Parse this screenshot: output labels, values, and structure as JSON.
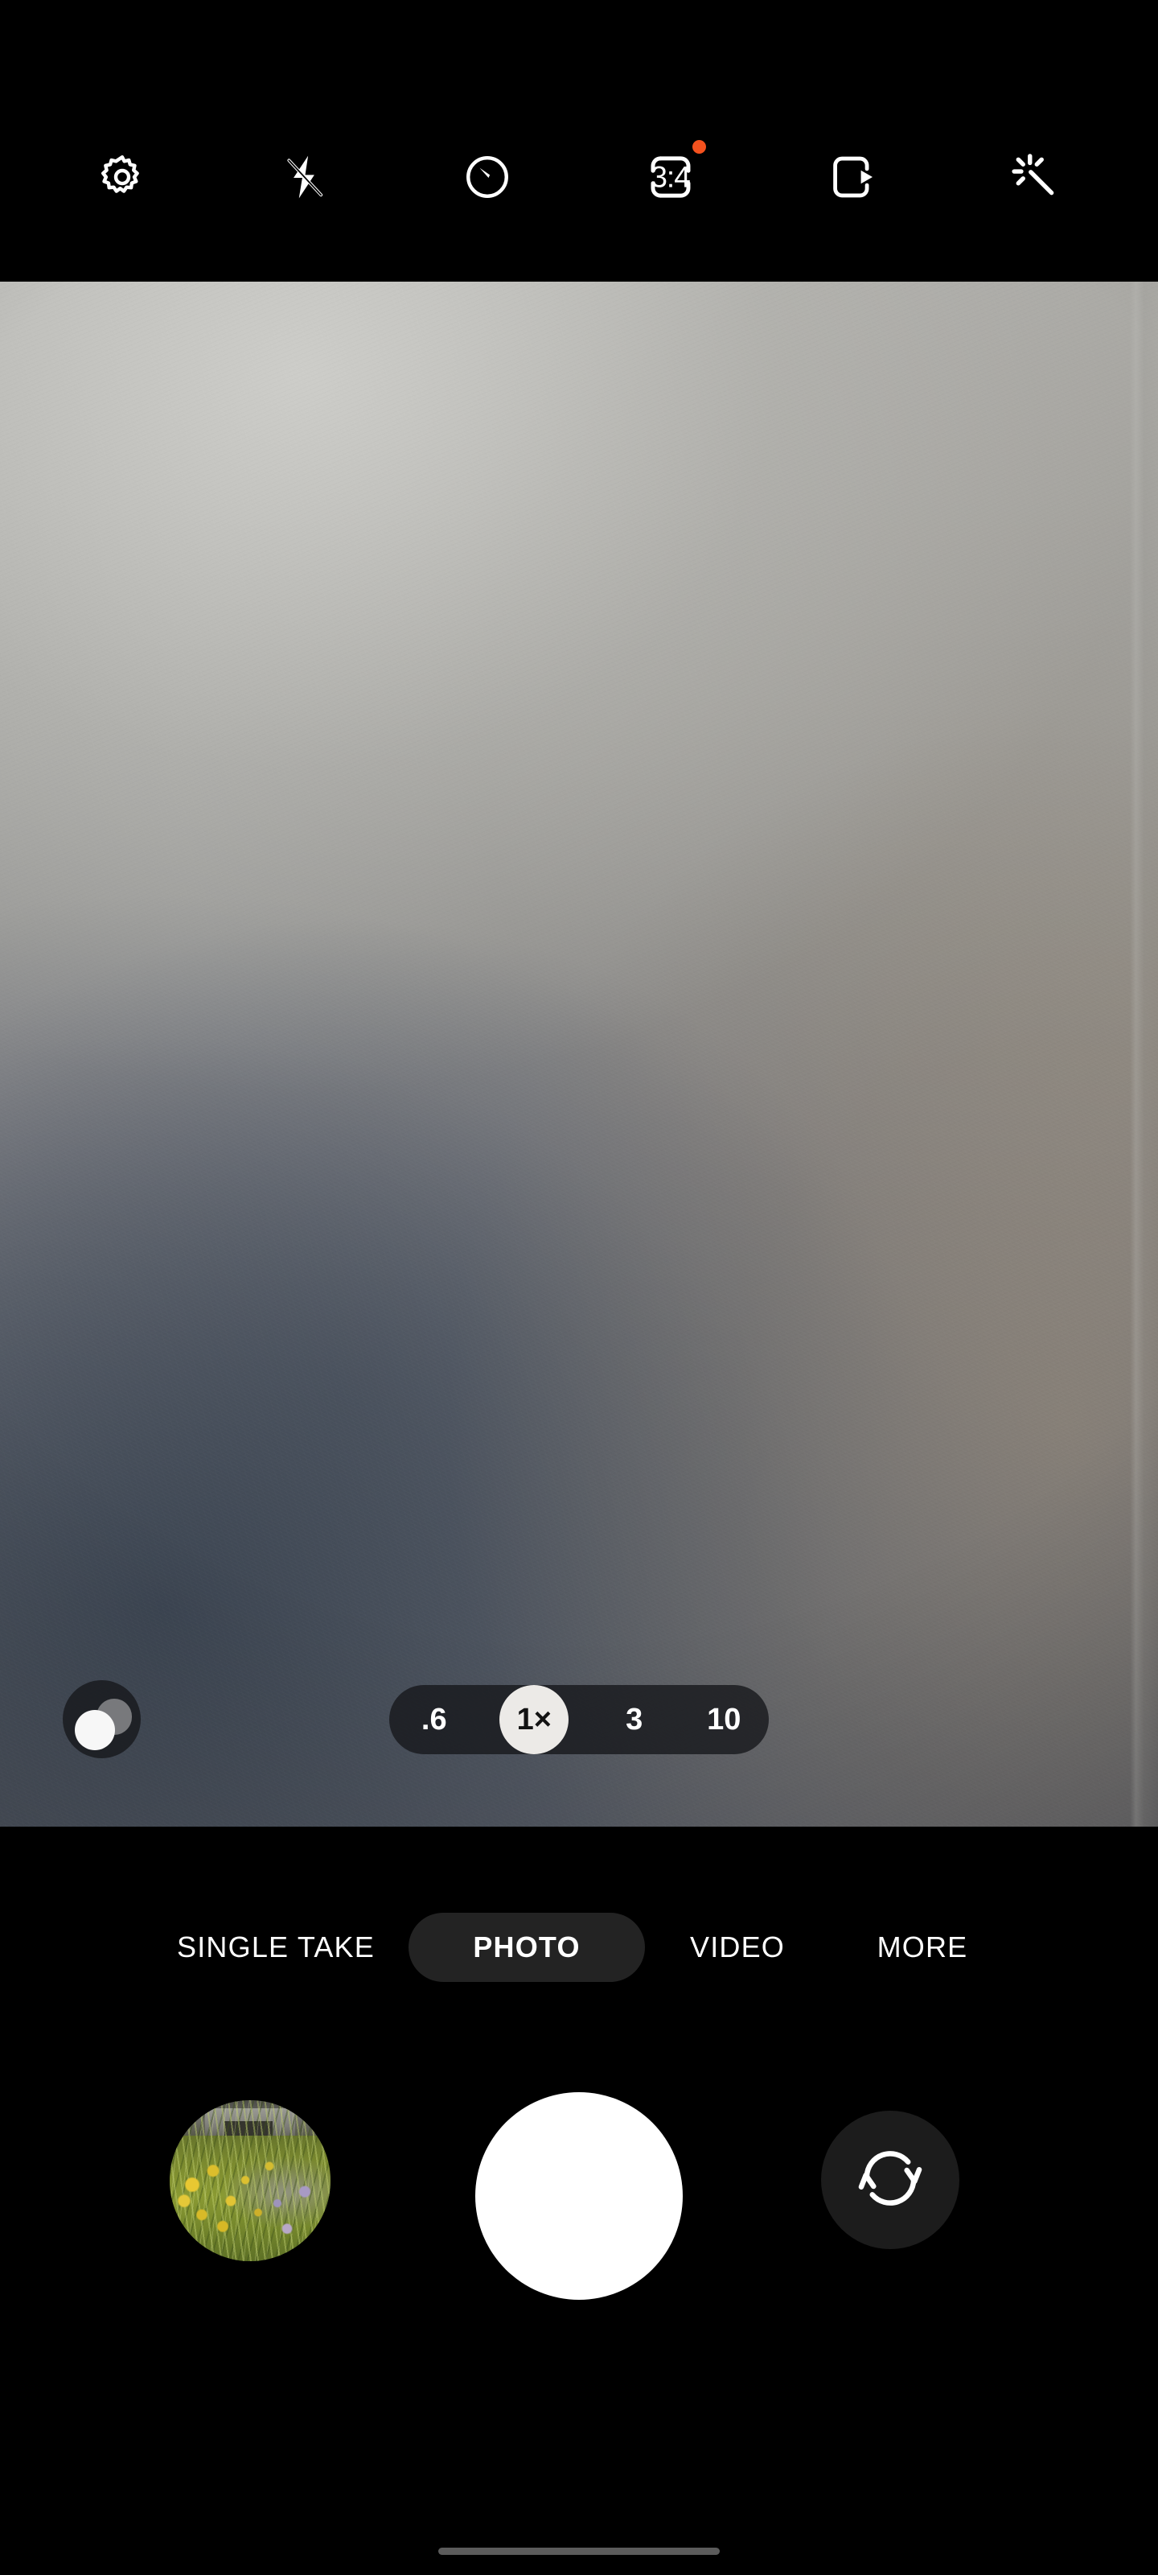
{
  "app": {
    "name": "Camera",
    "mode": "PHOTO"
  },
  "top_toolbar": {
    "items": [
      {
        "name": "settings",
        "icon": "gear-icon",
        "label": "Settings"
      },
      {
        "name": "flash",
        "icon": "flash-off-icon",
        "label": "Flash off"
      },
      {
        "name": "timer",
        "icon": "timer-icon",
        "label": "Timer"
      },
      {
        "name": "aspect_ratio",
        "icon": "aspect-ratio-icon",
        "label": "3:4",
        "value": "3:4",
        "badge": true
      },
      {
        "name": "motion_photo",
        "icon": "motion-photo-icon",
        "label": "Motion photo"
      },
      {
        "name": "filters",
        "icon": "magic-wand-icon",
        "label": "Filters"
      }
    ],
    "badge_color": "#f4511e"
  },
  "viewfinder": {
    "bokeh_toggle": {
      "label": "Portrait blur",
      "enabled": false
    },
    "zoom": {
      "levels": [
        {
          "label": ".6",
          "value": 0.6,
          "active": false
        },
        {
          "label": "1×",
          "value": 1,
          "active": true
        },
        {
          "label": "3",
          "value": 3,
          "active": false
        },
        {
          "label": "10",
          "value": 10,
          "active": false
        }
      ],
      "selected": "1×"
    }
  },
  "modes": {
    "tabs": [
      {
        "label": "SINGLE TAKE",
        "active": false
      },
      {
        "label": "PHOTO",
        "active": true
      },
      {
        "label": "VIDEO",
        "active": false
      },
      {
        "label": "MORE",
        "active": false
      }
    ]
  },
  "capture_bar": {
    "gallery": {
      "label": "Gallery",
      "icon": "gallery-thumbnail"
    },
    "shutter": {
      "label": "Take picture",
      "icon": "shutter-icon"
    },
    "flip": {
      "label": "Switch camera",
      "icon": "flip-camera-icon"
    }
  },
  "system": {
    "nav_pill": "Home gesture bar"
  },
  "colors": {
    "background": "#000000",
    "accent_badge": "#f4511e",
    "chip_background": "rgba(22,24,28,0.80)",
    "active_chip": "#eceae7",
    "mode_active_pill": "#232323",
    "shutter": "#ffffff",
    "flip_button": "#1c1c1c",
    "nav_pill": "#5b5b5b"
  }
}
